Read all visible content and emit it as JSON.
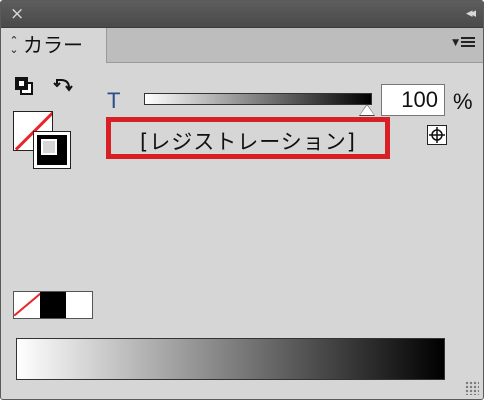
{
  "window": {
    "close_glyph": "×",
    "collapse_glyph": "◂◂"
  },
  "tab": {
    "label": "カラー",
    "arrows_glyph": "⌃⌄"
  },
  "tint": {
    "letter": "T",
    "value": "100",
    "unit": "%",
    "slider_fraction": 1.0
  },
  "swatch_name": "[レジストレーション]",
  "icons": [
    "close-icon",
    "collapse-icon",
    "panel-menu-icon",
    "default-fill-stroke-icon",
    "swap-fill-stroke-icon",
    "registration-icon",
    "resize-grip-icon"
  ],
  "colors": {
    "panel_bg": "#d6d6d6",
    "titlebar_bg": "#4a4a4a",
    "highlight_border": "#d91f26",
    "none_slash": "#e8262a",
    "tint_letter": "#2d4d8a"
  },
  "quick_swatches": [
    "none",
    "black",
    "white"
  ]
}
